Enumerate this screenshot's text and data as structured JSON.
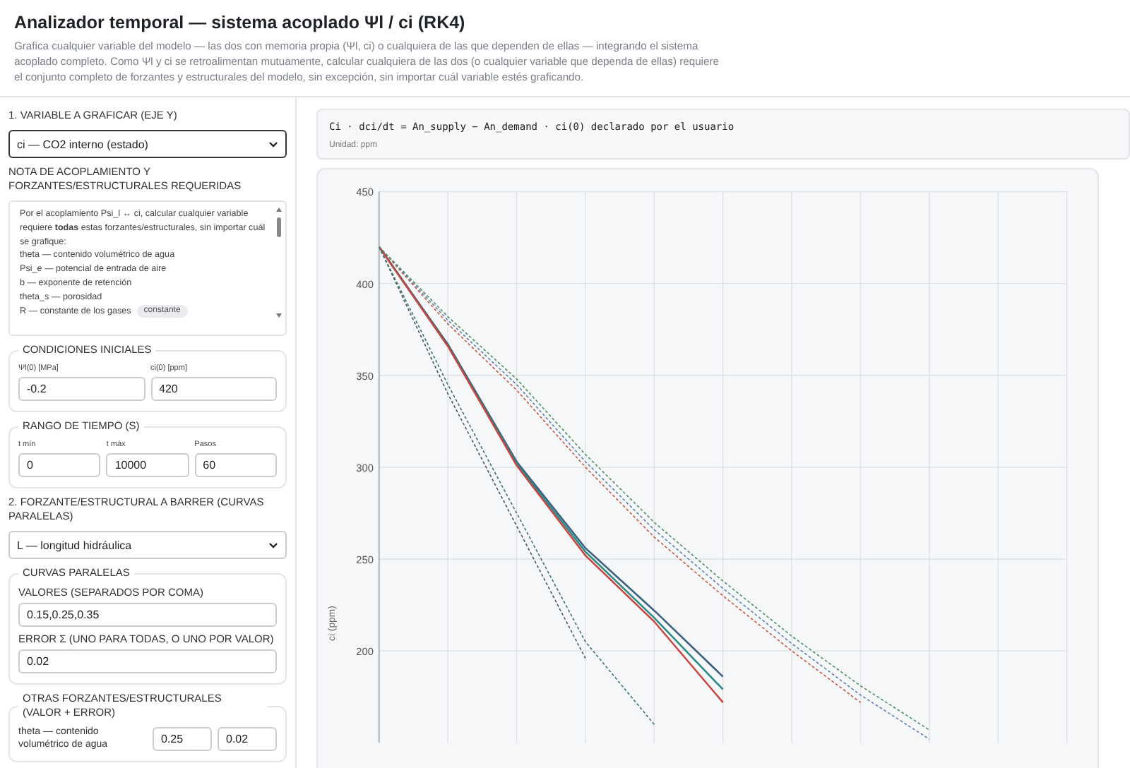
{
  "header": {
    "title": "Analizador temporal — sistema acoplado Ψl / ci (RK4)",
    "description": "Grafica cualquier variable del modelo — las dos con memoria propia (Ψl, ci) o cualquiera de las que dependen de ellas — integrando el sistema acoplado completo. Como Ψl y ci se retroalimentan mutuamente, calcular cualquiera de las dos (o cualquier variable que dependa de ellas) requiere el conjunto completo de forzantes y estructurales del modelo, sin excepción, sin importar cuál variable estés graficando."
  },
  "sidebar": {
    "variable": {
      "label": "1. VARIABLE A GRAFICAR (EJE Y)",
      "value": "ci — CO2 interno (estado)"
    },
    "note": {
      "label": "NOTA DE ACOPLAMIENTO Y FORZANTES/ESTRUCTURALES REQUERIDAS",
      "intro": "Por el acoplamiento Psi_l ↔ ci, calcular cualquier variable requiere **todas** estas forzantes/estructurales, sin importar cuál se grafique:",
      "items": [
        {
          "text": "theta — contenido volumétrico de agua"
        },
        {
          "text": "Psi_e — potencial de entrada de aire"
        },
        {
          "text": "b — exponente de retención"
        },
        {
          "text": "theta_s — porosidad"
        },
        {
          "text": "R — constante de los gases",
          "badge": "constante"
        }
      ]
    },
    "initial": {
      "legend": "CONDICIONES INICIALES",
      "fields": [
        {
          "label": "Ψl(0) [MPa]",
          "value": "-0.2"
        },
        {
          "label": "ci(0) [ppm]",
          "value": "420"
        }
      ]
    },
    "time": {
      "legend": "RANGO DE TIEMPO (S)",
      "fields": [
        {
          "label": "t mín",
          "value": "0"
        },
        {
          "label": "t máx",
          "value": "10000"
        },
        {
          "label": "Pasos",
          "value": "60"
        }
      ]
    },
    "sweep": {
      "label": "2. FORZANTE/ESTRUCTURAL A BARRER (CURVAS PARALELAS)",
      "value": "L — longitud hidráulica"
    },
    "curves": {
      "legend": "CURVAS PARALELAS",
      "fields": [
        {
          "label": "VALORES (SEPARADOS POR COMA)",
          "value": "0.15,0.25,0.35"
        },
        {
          "label": "ERROR Σ (UNO PARA TODAS, O UNO POR VALOR)",
          "value": "0.02"
        }
      ]
    },
    "others": {
      "legend": "OTRAS FORZANTES/ESTRUCTURALES (VALOR + ERROR)",
      "rows": [
        {
          "label": "theta — contenido volumétrico de agua",
          "value": "0.25",
          "error": "0.02"
        }
      ]
    }
  },
  "main": {
    "equation": "Ci · dci/dt = An_supply − An_demand · ci(0) declarado por el usuario",
    "unit": "Unidad: ppm",
    "chart_data": {
      "type": "line",
      "ylabel": "ci (ppm)",
      "grid": true,
      "ylim": [
        150,
        450
      ],
      "yticks": [
        200,
        250,
        300,
        350,
        400,
        450
      ],
      "series": [
        {
          "color": "#4a8f5a",
          "line_style": "dashed",
          "values": [
            420,
            382,
            348,
            307,
            270,
            238,
            208,
            181,
            157
          ]
        },
        {
          "color": "#5a7fb0",
          "line_style": "dashed",
          "values": [
            420,
            380,
            345,
            303,
            266,
            234,
            204,
            176,
            152
          ]
        },
        {
          "color": "#c8553d",
          "line_style": "dashed",
          "values": [
            420,
            378,
            342,
            300,
            262,
            230,
            200,
            172,
            null
          ]
        },
        {
          "color": "#3a6f6a",
          "line_style": "dashed",
          "values": [
            420,
            345,
            275,
            205,
            160,
            null,
            null,
            null,
            null
          ]
        },
        {
          "color": "#3f5560",
          "line_style": "dashed",
          "values": [
            420,
            340,
            268,
            196,
            null,
            null,
            null,
            null,
            null
          ]
        },
        {
          "color": "#c8453d",
          "line_style": "solid",
          "values": [
            420,
            366,
            301,
            252,
            216,
            172,
            null,
            null,
            null
          ]
        },
        {
          "color": "#2a8a86",
          "line_style": "solid",
          "values": [
            420,
            366,
            302,
            254,
            218,
            179,
            null,
            null,
            null
          ]
        },
        {
          "color": "#3a5f80",
          "line_style": "solid",
          "values": [
            420,
            367,
            303,
            256,
            222,
            186,
            null,
            null,
            null
          ]
        }
      ]
    }
  }
}
